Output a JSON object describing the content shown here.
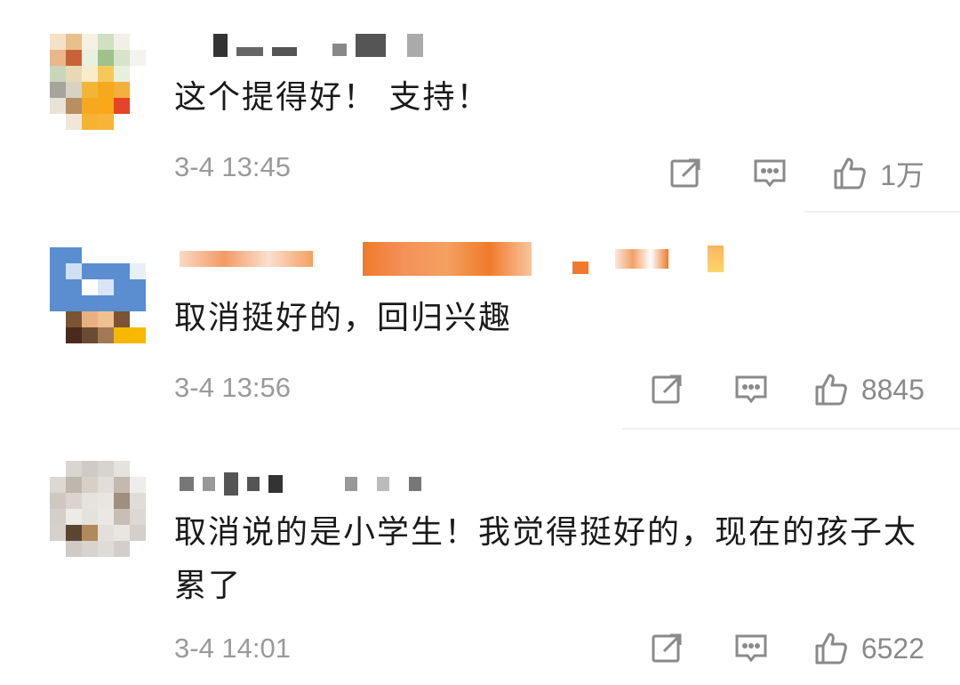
{
  "comments": [
    {
      "text": "这个提得好！ 支持！",
      "time": "3-4 13:45",
      "likes": "1万"
    },
    {
      "text": "取消挺好的，回归兴趣",
      "time": "3-4 13:56",
      "likes": "8845"
    },
    {
      "text": "取消说的是小学生！我觉得挺好的，现在的孩子太累了",
      "time": "3-4 14:01",
      "likes": "6522"
    }
  ],
  "icons": {
    "share": "share-icon",
    "reply": "comment-icon",
    "like": "thumbs-up-icon"
  },
  "colors": {
    "text": "#1a1a1a",
    "meta": "#9a9a9a",
    "icon": "#8a8a8a",
    "username_orange": "#f07a2a"
  }
}
